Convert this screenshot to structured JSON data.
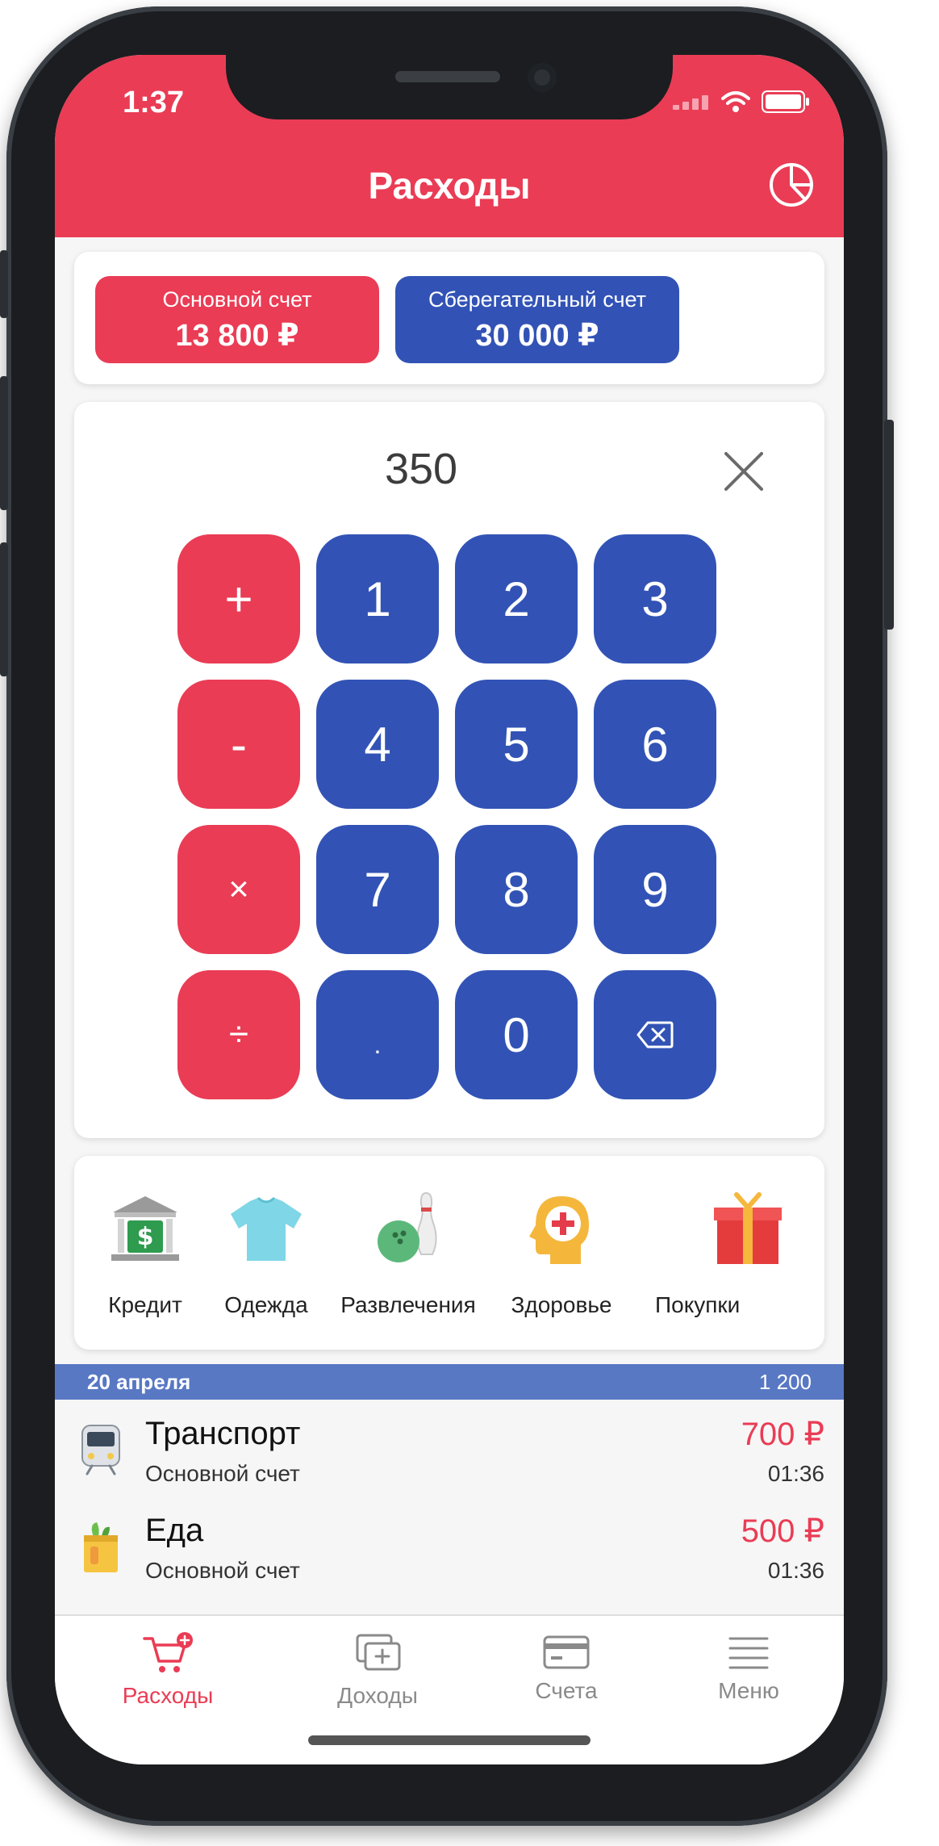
{
  "status": {
    "time": "1:37"
  },
  "header": {
    "title": "Расходы"
  },
  "accounts": [
    {
      "name": "Основной счет",
      "balance": "13 800 ₽",
      "color": "#ea3c55"
    },
    {
      "name": "Сберегательный счет",
      "balance": "30 000 ₽",
      "color": "#3253b5"
    }
  ],
  "calculator": {
    "display": "350",
    "keys": [
      "+",
      "1",
      "2",
      "3",
      "-",
      "4",
      "5",
      "6",
      "×",
      "7",
      "8",
      "9",
      "÷",
      ".",
      "0",
      "backspace-icon"
    ]
  },
  "categories": [
    {
      "label": "Кредит",
      "icon": "bank-icon"
    },
    {
      "label": "Одежда",
      "icon": "tshirt-icon"
    },
    {
      "label": "Развлечения",
      "icon": "bowling-icon"
    },
    {
      "label": "Здоровье",
      "icon": "health-icon"
    },
    {
      "label": "Покупки",
      "icon": "gift-icon"
    }
  ],
  "day": {
    "date": "20 апреля",
    "sum": "1 200"
  },
  "transactions": [
    {
      "name": "Транспорт",
      "account": "Основной счет",
      "amount": "700 ₽",
      "time": "01:36",
      "icon": "train-icon"
    },
    {
      "name": "Еда",
      "account": "Основной счет",
      "amount": "500 ₽",
      "time": "01:36",
      "icon": "grocery-icon"
    }
  ],
  "tabs": [
    {
      "label": "Расходы",
      "active": true,
      "icon": "cart-icon"
    },
    {
      "label": "Доходы",
      "active": false,
      "icon": "add-money-icon"
    },
    {
      "label": "Счета",
      "active": false,
      "icon": "card-icon"
    },
    {
      "label": "Меню",
      "active": false,
      "icon": "menu-icon"
    }
  ],
  "colors": {
    "accent": "#ea3c55",
    "primary": "#3253b5",
    "date_bar": "#5878c4"
  }
}
